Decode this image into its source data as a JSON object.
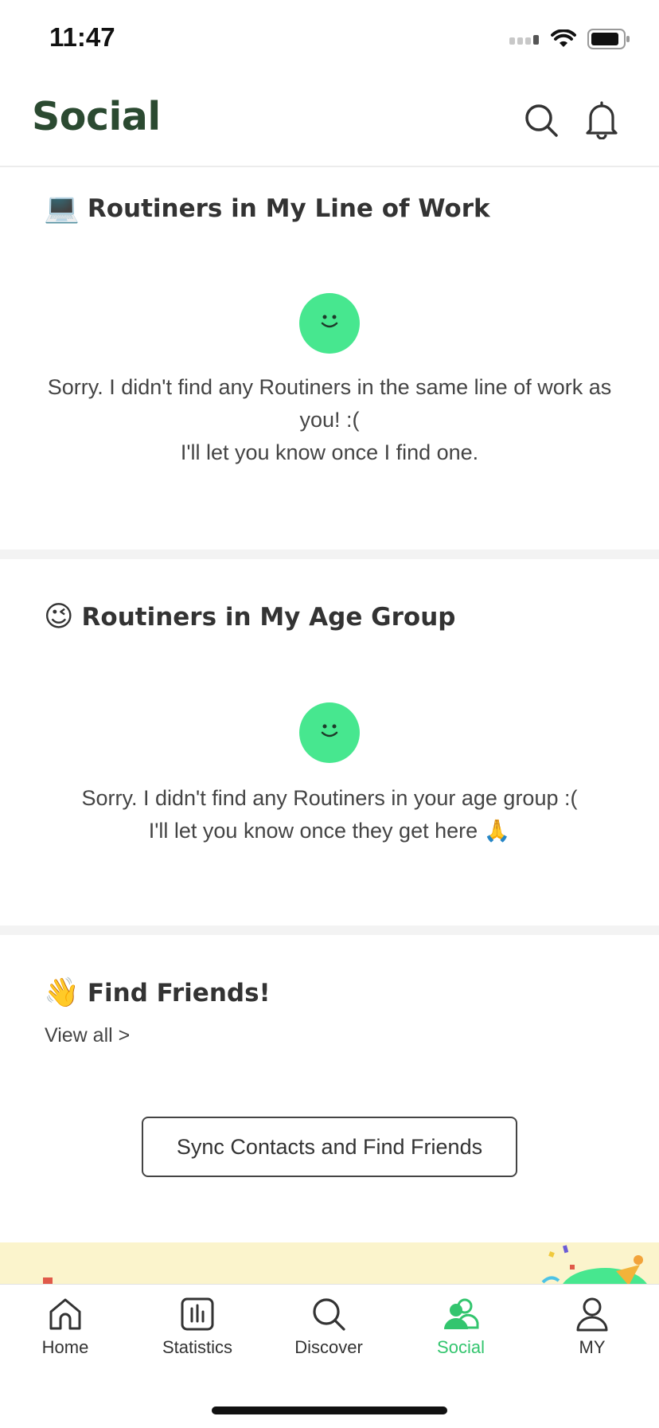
{
  "status_bar": {
    "time": "11:47"
  },
  "header": {
    "title": "Social",
    "search_icon": "search-icon",
    "bell_icon": "bell-icon"
  },
  "sections": {
    "work": {
      "emoji": "💻",
      "title": "Routiners in My Line of Work",
      "message_line1": "Sorry. I didn't find any Routiners in the same line of work as",
      "message_line2": "you! :(",
      "message_line3": "I'll let you know once I find one."
    },
    "age": {
      "emoji": "😉",
      "title": "Routiners in My Age Group",
      "message_line1": "Sorry. I didn't find any Routiners in your age group :(",
      "message_line2": "I'll let you know once they get here 🙏"
    },
    "friends": {
      "emoji": "👋",
      "title": "Find Friends!",
      "view_all": "View all >",
      "sync_button": "Sync Contacts and Find Friends"
    }
  },
  "tabbar": {
    "items": [
      {
        "label": "Home",
        "icon": "home-icon"
      },
      {
        "label": "Statistics",
        "icon": "statistics-icon"
      },
      {
        "label": "Discover",
        "icon": "search-icon"
      },
      {
        "label": "Social",
        "icon": "social-icon",
        "active": true
      },
      {
        "label": "MY",
        "icon": "profile-icon"
      }
    ]
  },
  "colors": {
    "accent": "#47e78f",
    "active_tab": "#33c56e",
    "header_title": "#2b4a31",
    "banner": "#fbf4cc"
  }
}
